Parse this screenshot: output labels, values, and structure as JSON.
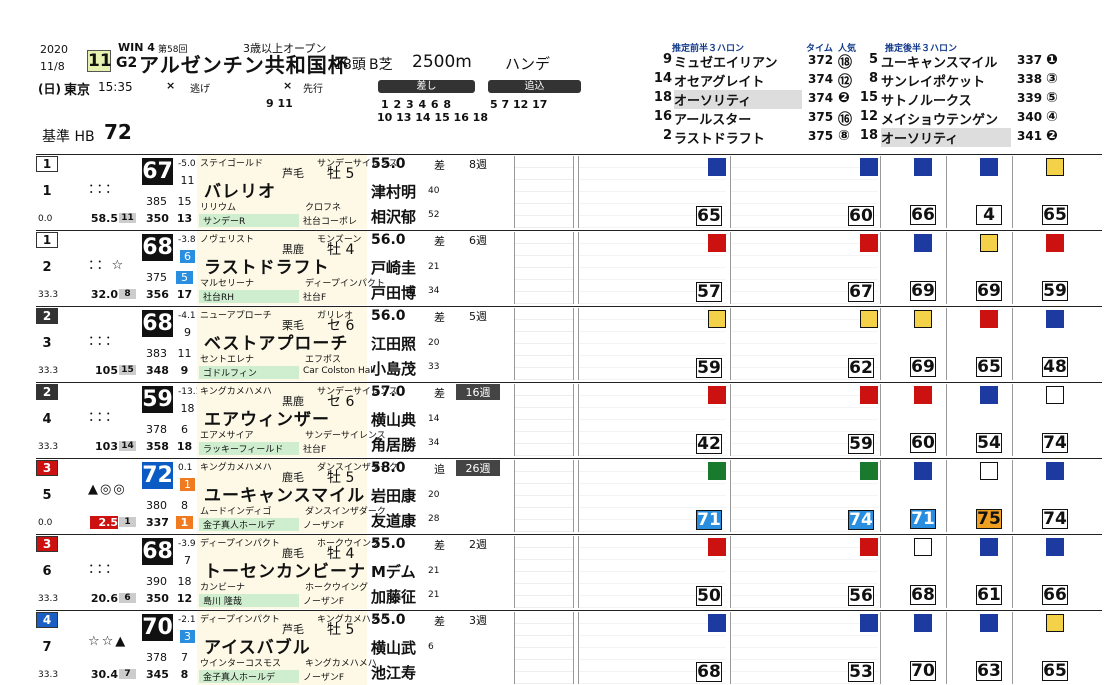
{
  "header": {
    "year": "2020",
    "date": "11/8",
    "day": "(日)",
    "venue": "東京",
    "time": "15:35",
    "win": "WIN 4",
    "kai": "第58回",
    "race_no": "11",
    "grade": "G2",
    "race_name": "アルゼンチン共和国杯",
    "conditions": "3歳以上オープン",
    "field": "18頭",
    "surface": "B芝",
    "distance": "2500m",
    "handicap": "ハンデ",
    "base_label": "基準 HB",
    "base_value": "72"
  },
  "pace": {
    "nige_label": "逃げ",
    "senko_label": "先行",
    "sashi_label": "差し",
    "oikomi_label": "追込",
    "nige": "",
    "senko": "9 11",
    "sashi_top": "1 2 3 4 6 8",
    "sashi_bot": "10 13 14 15 16 18",
    "oikomi": "5 7 12 17",
    "x_mark": "×"
  },
  "rank_early": {
    "title": "推定前半３ハロン",
    "time_h": "タイム",
    "pop_h": "人気",
    "rows": [
      {
        "no": "9",
        "name": "ミュゼエイリアン",
        "time": "372",
        "pop": "⑱"
      },
      {
        "no": "14",
        "name": "オセアグレイト",
        "time": "374",
        "pop": "⑫"
      },
      {
        "no": "18",
        "name": "オーソリティ",
        "time": "374",
        "pop": "❷"
      },
      {
        "no": "16",
        "name": "アールスター",
        "time": "375",
        "pop": "⑯"
      },
      {
        "no": "2",
        "name": "ラストドラフト",
        "time": "375",
        "pop": "⑧"
      }
    ]
  },
  "rank_late": {
    "title": "推定後半３ハロン",
    "rows": [
      {
        "no": "5",
        "name": "ユーキャンスマイル",
        "time": "337",
        "pop": "❶"
      },
      {
        "no": "8",
        "name": "サンレイポケット",
        "time": "338",
        "pop": "③"
      },
      {
        "no": "15",
        "name": "サトノルークス",
        "time": "339",
        "pop": "⑤"
      },
      {
        "no": "12",
        "name": "メイショウテンゲン",
        "time": "340",
        "pop": "④"
      },
      {
        "no": "18",
        "name": "オーソリティ",
        "time": "341",
        "pop": "❷"
      }
    ]
  },
  "horses": [
    {
      "gate": "1",
      "num": "1",
      "marks": "：：：",
      "odds": "58.5",
      "oddsrk": "11",
      "r1": "385",
      "r1k": "15",
      "r2": "350",
      "r2k": "13",
      "left": "0.0",
      "idx": "67",
      "d": "-5.0",
      "dv": "11",
      "sire": "ステイゴールド",
      "dam_sire": "サンデーサイレンス",
      "color": "芦毛",
      "sex": "牡 5",
      "name": "バレリオ",
      "dam": "リリウム",
      "bms": "クロフネ",
      "owner": "サンデーR",
      "farm": "社台コーポレ",
      "wt": "55.0",
      "style": "差",
      "jk": "津村明",
      "jkw": "40",
      "trainer": "相沢郁",
      "tw": "52",
      "weeks": "8週",
      "spd": [
        "65",
        "60"
      ],
      "recent": [
        "66",
        "4",
        "65"
      ]
    },
    {
      "gate": "1",
      "num": "2",
      "marks": "：：☆",
      "odds": "32.0",
      "oddsrk": "8",
      "r1": "375",
      "r1k": "5",
      "r2": "356",
      "r2k": "17",
      "left": "33.3",
      "idx": "68",
      "d": "-3.8",
      "dv": "6",
      "sire": "ノヴェリスト",
      "dam_sire": "モンズーン",
      "color": "黒鹿",
      "sex": "牡 4",
      "name": "ラストドラフト",
      "dam": "マルセリーナ",
      "bms": "ディープインパクト",
      "owner": "社台RH",
      "farm": "社台F",
      "wt": "56.0",
      "style": "差",
      "jk": "戸崎圭",
      "jkw": "21",
      "trainer": "戸田博",
      "tw": "34",
      "weeks": "6週",
      "spd": [
        "57",
        "67"
      ],
      "recent": [
        "69",
        "69",
        "59"
      ]
    },
    {
      "gate": "2",
      "num": "3",
      "marks": "：：：",
      "odds": "105",
      "oddsrk": "15",
      "r1": "383",
      "r1k": "11",
      "r2": "348",
      "r2k": "9",
      "left": "33.3",
      "idx": "68",
      "d": "-4.1",
      "dv": "9",
      "sire": "ニューアプローチ",
      "dam_sire": "ガリレオ",
      "color": "栗毛",
      "sex": "セ 6",
      "name": "ベストアプローチ",
      "dam": "セントエレナ",
      "bms": "エフポス",
      "owner": "ゴドルフィン",
      "farm": "Car Colston Hall",
      "wt": "56.0",
      "style": "差",
      "jk": "江田照",
      "jkw": "20",
      "trainer": "小島茂",
      "tw": "33",
      "weeks": "5週",
      "spd": [
        "59",
        "62"
      ],
      "recent": [
        "69",
        "65",
        "48"
      ]
    },
    {
      "gate": "2",
      "num": "4",
      "marks": "：：：",
      "odds": "103",
      "oddsrk": "14",
      "r1": "378",
      "r1k": "6",
      "r2": "358",
      "r2k": "18",
      "left": "33.3",
      "idx": "59",
      "d": "-13.1",
      "dv": "18",
      "sire": "キングカメハメハ",
      "dam_sire": "サンデーサイレンス",
      "color": "黒鹿",
      "sex": "セ 6",
      "name": "エアウィンザー",
      "dam": "エアメサイア",
      "bms": "サンデーサイレンス",
      "owner": "ラッキーフィールド",
      "farm": "社台F",
      "wt": "57.0",
      "style": "差",
      "jk": "横山典",
      "jkw": "14",
      "trainer": "角居勝",
      "tw": "34",
      "weeks": "16週",
      "spd": [
        "42",
        "59"
      ],
      "recent": [
        "60",
        "54",
        "74"
      ]
    },
    {
      "gate": "3",
      "num": "5",
      "marks": "▲◎◎",
      "odds": "2.5",
      "oddsrk": "1",
      "r1": "380",
      "r1k": "8",
      "r2": "337",
      "r2k": "1",
      "left": "0.0",
      "idx": "72",
      "d": "0.1",
      "dv": "1",
      "sire": "キングカメハメハ",
      "dam_sire": "ダンスインザダーク",
      "color": "鹿毛",
      "sex": "牡 5",
      "name": "ユーキャンスマイル",
      "dam": "ムードインディゴ",
      "bms": "ダンスインザダーク",
      "owner": "金子真人ホールデ",
      "farm": "ノーザンF",
      "wt": "58.0",
      "style": "追",
      "jk": "岩田康",
      "jkw": "20",
      "trainer": "友道康",
      "tw": "28",
      "weeks": "26週",
      "spd": [
        "71",
        "74"
      ],
      "recent": [
        "71",
        "75",
        "74"
      ]
    },
    {
      "gate": "3",
      "num": "6",
      "marks": "：：：",
      "odds": "20.6",
      "oddsrk": "6",
      "r1": "390",
      "r1k": "18",
      "r2": "350",
      "r2k": "12",
      "left": "33.3",
      "idx": "68",
      "d": "-3.9",
      "dv": "7",
      "sire": "ディープインパクト",
      "dam_sire": "ホークウイング",
      "color": "鹿毛",
      "sex": "牡 4",
      "name": "トーセンカンビーナ",
      "dam": "カンビーナ",
      "bms": "ホークウイング",
      "owner": "島川 隆哉",
      "farm": "ノーザンF",
      "wt": "55.0",
      "style": "差",
      "jk": "Mデム",
      "jkw": "21",
      "trainer": "加藤征",
      "tw": "21",
      "weeks": "2週",
      "spd": [
        "50",
        "56"
      ],
      "recent": [
        "68",
        "61",
        "66"
      ]
    },
    {
      "gate": "4",
      "num": "7",
      "marks": "☆☆▲",
      "odds": "30.4",
      "oddsrk": "7",
      "r1": "378",
      "r1k": "7",
      "r2": "345",
      "r2k": "8",
      "left": "33.3",
      "idx": "70",
      "d": "-2.1",
      "dv": "3",
      "sire": "ディープインパクト",
      "dam_sire": "キングカメハメハ",
      "color": "芦毛",
      "sex": "牡 5",
      "name": "アイスバブル",
      "dam": "ウインターコスモス",
      "bms": "キングカメハメハ",
      "owner": "金子真人ホールデ",
      "farm": "ノーザンF",
      "wt": "55.0",
      "style": "差",
      "jk": "横山武",
      "jkw": "6",
      "trainer": "池江寿",
      "tw": "",
      "weeks": "3週",
      "spd": [
        "68",
        "53"
      ],
      "recent": [
        "70",
        "63",
        "65"
      ]
    }
  ]
}
